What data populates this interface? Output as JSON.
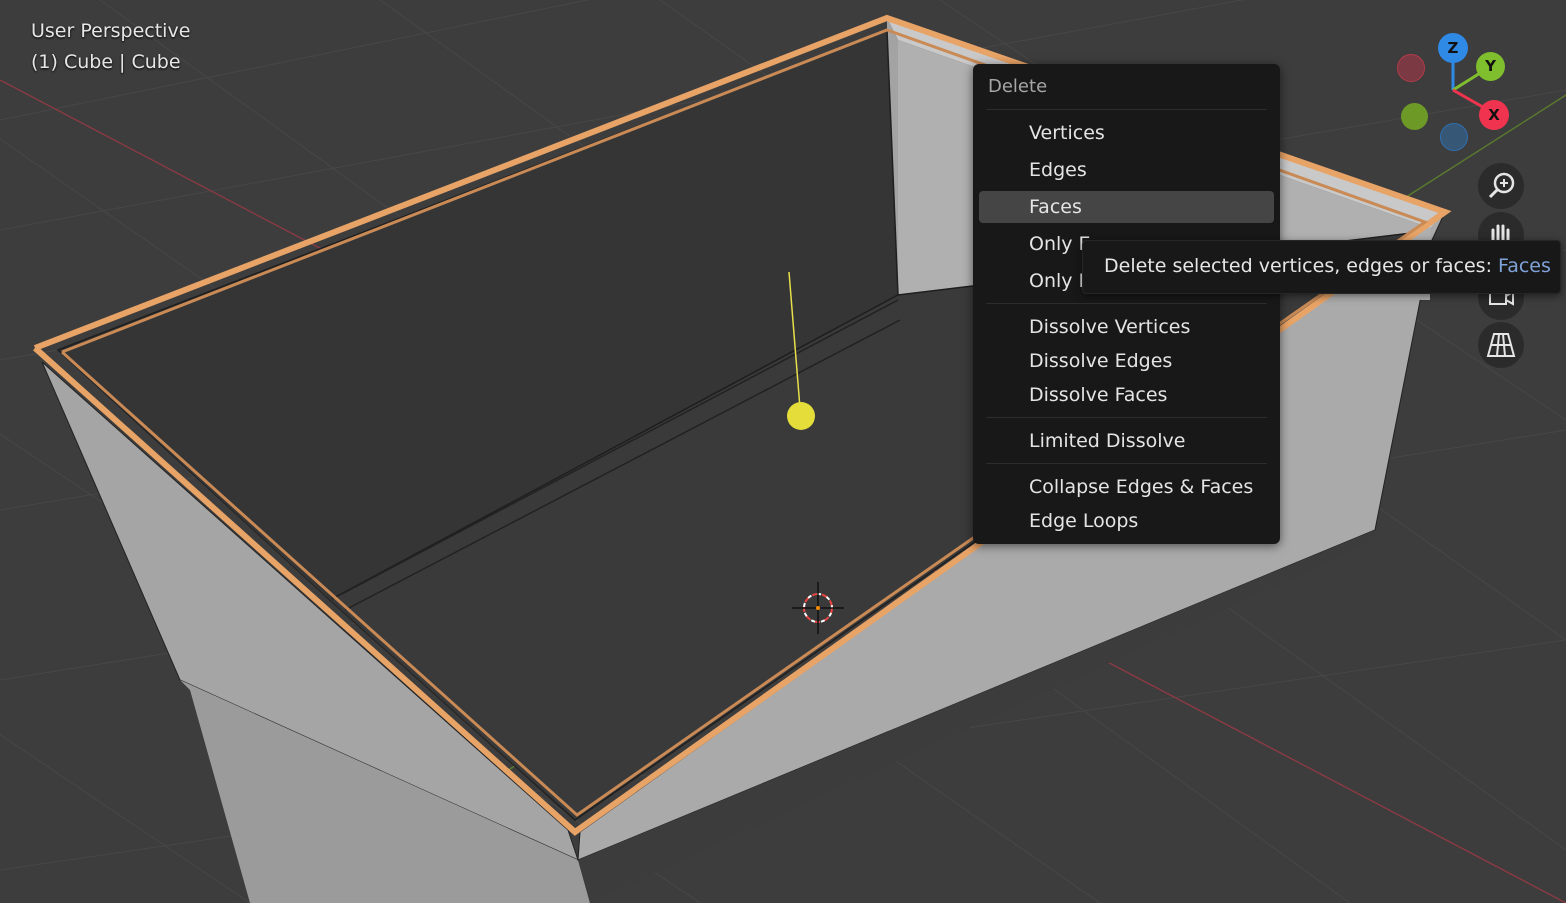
{
  "viewport": {
    "title": "User Perspective",
    "object_label": "(1) Cube | Cube"
  },
  "menu": {
    "title": "Delete",
    "groups": [
      {
        "items": [
          {
            "label": "Vertices",
            "active": false
          },
          {
            "label": "Edges",
            "active": false
          },
          {
            "label": "Faces",
            "active": true
          },
          {
            "label": "Only E",
            "active": false
          },
          {
            "label": "Only F",
            "active": false
          }
        ]
      },
      {
        "items": [
          {
            "label": "Dissolve Vertices",
            "active": false
          },
          {
            "label": "Dissolve Edges",
            "active": false
          },
          {
            "label": "Dissolve Faces",
            "active": false
          }
        ]
      },
      {
        "items": [
          {
            "label": "Limited Dissolve",
            "active": false
          }
        ]
      },
      {
        "items": [
          {
            "label": "Collapse Edges & Faces",
            "active": false
          },
          {
            "label": "Edge Loops",
            "active": false
          }
        ]
      }
    ]
  },
  "tooltip": {
    "text": "Delete selected vertices, edges or faces:",
    "value": "Faces"
  },
  "gizmo": {
    "z_label": "Z",
    "y_label": "Y",
    "x_label": "X",
    "colors": {
      "x": "#f0344f",
      "y": "#7fbf2e",
      "z": "#2f8ae6"
    }
  },
  "nav_buttons": [
    {
      "name": "zoom-icon"
    },
    {
      "name": "pan-hand-icon"
    },
    {
      "name": "camera-icon"
    },
    {
      "name": "perspective-grid-icon"
    }
  ],
  "colors": {
    "background": "#3d3d3d",
    "selection": "#e8a366",
    "menu_bg": "#181818",
    "menu_active": "#454545",
    "tooltip_value": "#7fa3d8"
  }
}
